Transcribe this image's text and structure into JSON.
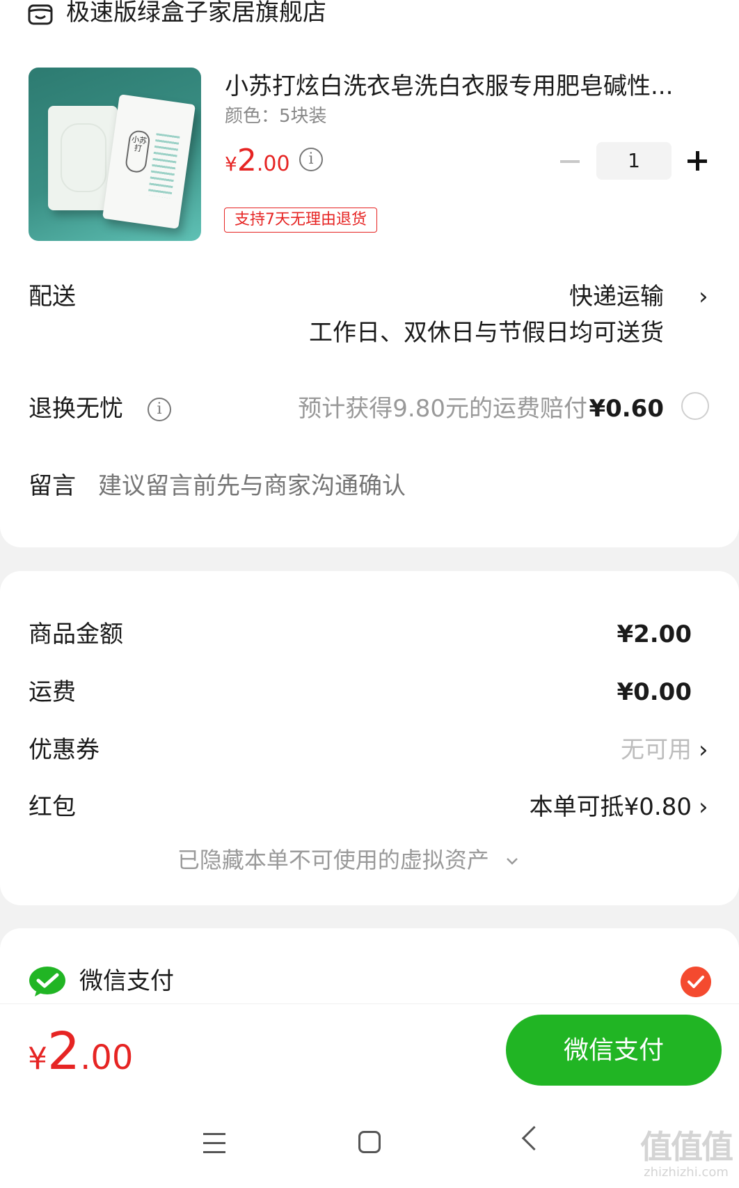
{
  "store": {
    "name": "极速版绿盒子家居旗舰店",
    "icon": "store-icon"
  },
  "product": {
    "title": "小苏打炫白洗衣皂洗白衣服专用肥皂碱性...",
    "spec": "颜色：5块装",
    "price_currency": "¥",
    "price_int": "2",
    "price_dec": ".00",
    "info_icon": "i",
    "quantity": "1",
    "return_tag": "支持7天无理由退货",
    "image_text": "小苏打"
  },
  "delivery": {
    "label": "配送",
    "method": "快递运输",
    "note": "工作日、双休日与节假日均可送货"
  },
  "return_insurance": {
    "label": "退换无忧",
    "info_icon": "i",
    "desc": "预计获得9.80元的运费赔付",
    "price": "¥0.60"
  },
  "message": {
    "label": "留言",
    "placeholder": "建议留言前先与商家沟通确认"
  },
  "summary": {
    "goods_label": "商品金额",
    "goods_value": "¥2.00",
    "shipping_label": "运费",
    "shipping_value": "¥0.00",
    "coupon_label": "优惠券",
    "coupon_value": "无可用",
    "redpacket_label": "红包",
    "redpacket_value": "本单可抵¥0.80",
    "hidden_assets": "已隐藏本单不可使用的虚拟资产"
  },
  "payment": {
    "method_label": "微信支付"
  },
  "bottom": {
    "total_currency": "¥",
    "total_int": "2",
    "total_dec": ".00",
    "pay_button": "微信支付"
  },
  "watermark": {
    "logo": "值值值",
    "site": "zhizhizhi.com"
  },
  "colors": {
    "accent_red": "#e62423",
    "wechat_green": "#21b524",
    "check_red": "#f44a2f"
  },
  "chevron": "›"
}
